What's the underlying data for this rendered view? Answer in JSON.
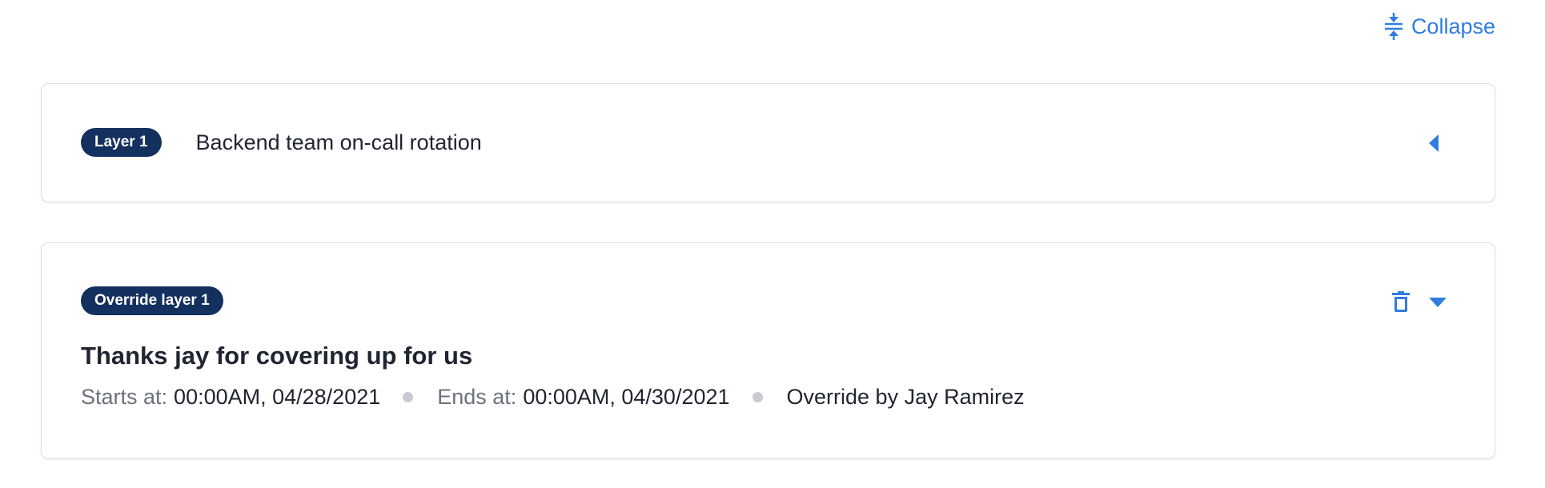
{
  "header": {
    "collapse_label": "Collapse",
    "collapse_icon": "collapse-vertical-icon",
    "accent_color": "#2f7de1"
  },
  "layer": {
    "badge": "Layer 1",
    "title": "Backend team on-call rotation",
    "expand_icon": "caret-left-icon"
  },
  "override": {
    "badge": "Override layer 1",
    "title": "Thanks jay for covering up for us",
    "starts_label": "Starts at:",
    "starts_value": "00:00AM, 04/28/2021",
    "ends_label": "Ends at:",
    "ends_value": "00:00AM, 04/30/2021",
    "override_by": "Override by Jay Ramirez",
    "delete_icon": "trash-icon",
    "toggle_icon": "caret-down-icon"
  },
  "colors": {
    "badge_bg": "#14305e",
    "accent": "#2f7de1",
    "muted_text": "#6b717c",
    "border": "#dcdfe4"
  }
}
